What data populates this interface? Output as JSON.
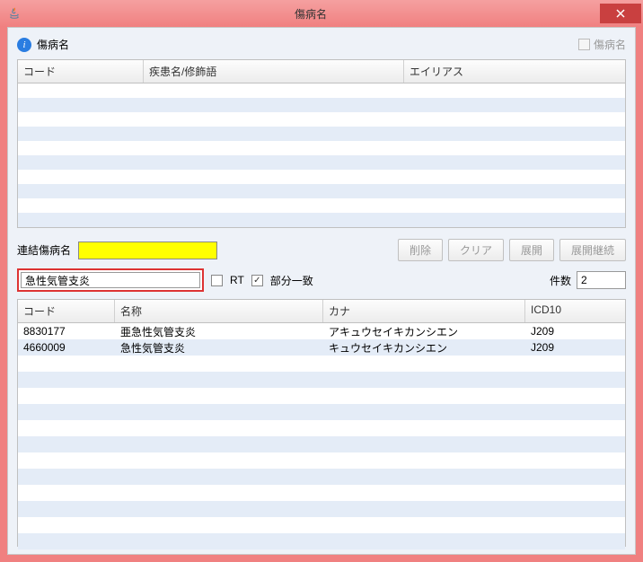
{
  "window": {
    "title": "傷病名"
  },
  "header": {
    "label": "傷病名",
    "checkbox_label": "傷病名"
  },
  "upper_table": {
    "columns": [
      "コード",
      "疾患名/修飾語",
      "エイリアス"
    ]
  },
  "linked": {
    "label": "連結傷病名"
  },
  "buttons": {
    "delete": "削除",
    "clear": "クリア",
    "expand": "展開",
    "expand_continue": "展開継続"
  },
  "search": {
    "value": "急性気管支炎",
    "rt_label": "RT",
    "partial_label": "部分一致",
    "count_label": "件数",
    "count_value": "2"
  },
  "lower_table": {
    "columns": [
      "コード",
      "名称",
      "カナ",
      "ICD10"
    ],
    "rows": [
      {
        "code": "8830177",
        "name": "亜急性気管支炎",
        "kana": "アキュウセイキカンシエン",
        "icd10": "J209"
      },
      {
        "code": "4660009",
        "name": "急性気管支炎",
        "kana": "キュウセイキカンシエン",
        "icd10": "J209"
      }
    ]
  }
}
